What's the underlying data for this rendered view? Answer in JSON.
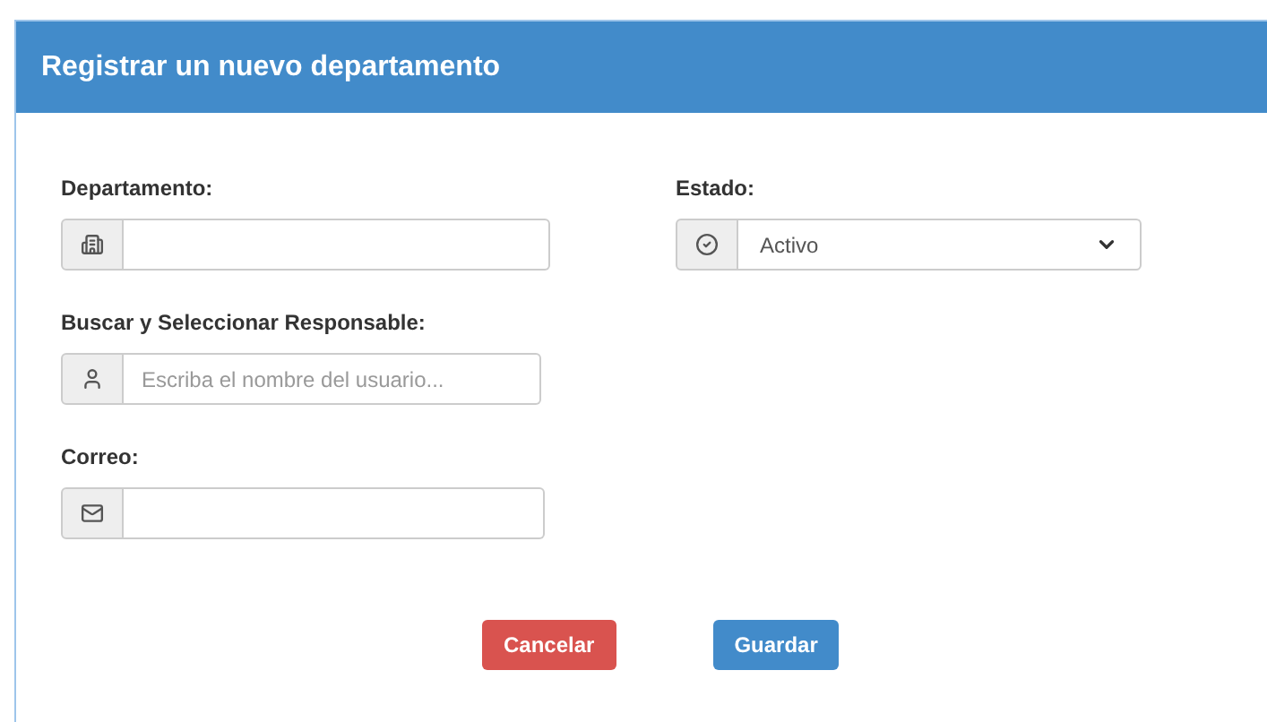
{
  "dialog": {
    "title": "Registrar un nuevo departamento"
  },
  "fields": [
    {
      "label": "Departamento:",
      "kind": "department"
    },
    {
      "label": "Estado:",
      "kind": "status",
      "value": "Activo"
    },
    {
      "label": "Buscar y Seleccionar Responsable:",
      "kind": "person",
      "placeholder": "Escriba el nombre del usuario..."
    },
    {
      "label": "Correo:",
      "kind": "email"
    }
  ],
  "buttons": [
    {
      "label": "Cancelar",
      "kind": "danger"
    },
    {
      "label": "Guardar",
      "kind": "primary"
    }
  ]
}
